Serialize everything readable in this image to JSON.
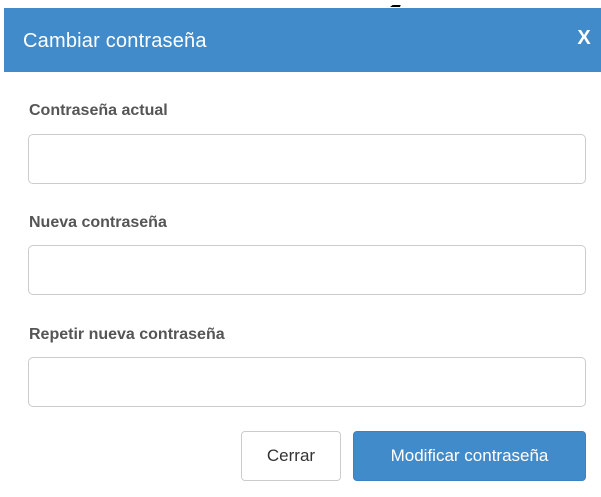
{
  "dialog": {
    "title": "Cambiar contraseña",
    "close_label": "X"
  },
  "fields": {
    "current": {
      "label": "Contraseña actual",
      "value": "",
      "placeholder": ""
    },
    "new": {
      "label": "Nueva contraseña",
      "value": "",
      "placeholder": ""
    },
    "repeat": {
      "label": "Repetir nueva contraseña",
      "value": "",
      "placeholder": ""
    }
  },
  "buttons": {
    "close_label": "Cerrar",
    "submit_label": "Modificar contraseña"
  },
  "colors": {
    "header_bg": "#428bca",
    "primary_button": "#428bca",
    "label_text": "#555555",
    "input_border": "#cccccc"
  }
}
